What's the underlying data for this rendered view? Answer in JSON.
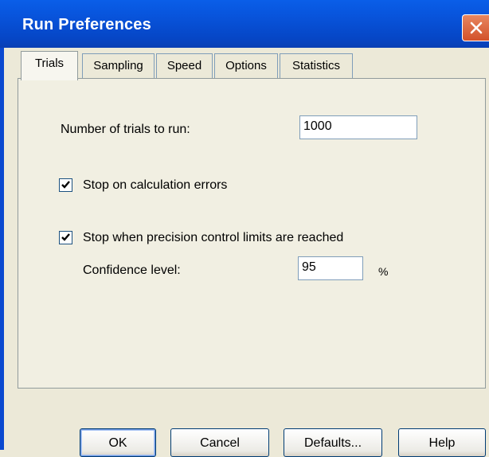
{
  "window": {
    "title": "Run Preferences"
  },
  "tabs": [
    {
      "label": "Trials"
    },
    {
      "label": "Sampling"
    },
    {
      "label": "Speed"
    },
    {
      "label": "Options"
    },
    {
      "label": "Statistics"
    }
  ],
  "trials": {
    "num_trials_label": "Number of trials to run:",
    "num_trials_value": "1000",
    "stop_on_errors_label": "Stop on calculation errors",
    "stop_on_errors_checked": true,
    "stop_precision_label": "Stop when precision control limits are reached",
    "stop_precision_checked": true,
    "confidence_label": "Confidence level:",
    "confidence_value": "95",
    "confidence_unit": "%"
  },
  "buttons": {
    "ok": "OK",
    "cancel": "Cancel",
    "defaults": "Defaults...",
    "help": "Help"
  },
  "colors": {
    "titlebar": "#0855dd",
    "close_button": "#d2512b",
    "dialog_bg": "#ece9d8"
  }
}
